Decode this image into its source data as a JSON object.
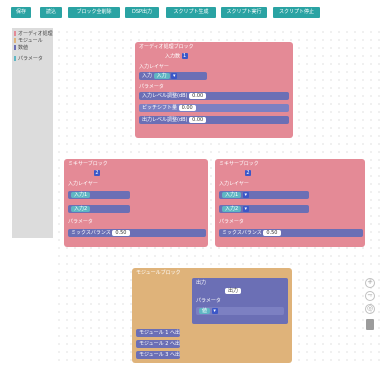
{
  "toolbar": {
    "buttons": [
      "保存",
      "読込",
      "ブロック全削除",
      "DSP出力",
      "スクリプト生成",
      "スクリプト実行",
      "スクリプト停止"
    ]
  },
  "sidebar": {
    "items": [
      {
        "label": "オーディオ処理",
        "color": "#e48a96"
      },
      {
        "label": "モジュール",
        "color": "#dfb37a"
      },
      {
        "label": "数値",
        "color": "#6b6fb5"
      },
      {
        "label": "パラメータ",
        "color": "#5fb6c4"
      }
    ]
  },
  "blocks": {
    "top_pink": {
      "header": "オーディオ処理ブロック",
      "slot_label": "入力数",
      "slot_num": "1",
      "input_label": "入力レイヤー",
      "input_value": "入力",
      "input_sel": "入力",
      "params_label": "パラメータ",
      "rows": [
        "入力レベル調整(dB)",
        "ピッチシフト量",
        "出力レベル調整(dB)"
      ],
      "row_mid": "0.00"
    },
    "mid_left": {
      "header": "ミキサーブロック",
      "slot_num": "2",
      "input_label": "入力レイヤー",
      "in1": "入力1",
      "in2": "入力2",
      "params_label": "パラメータ",
      "row": "ミックスバランス",
      "row_val": "0.50"
    },
    "mid_right": {
      "header": "ミキサーブロック",
      "slot_num": "2",
      "input_label": "入力レイヤー",
      "in1": "入力1",
      "in2": "入力2",
      "params_label": "パラメータ",
      "row": "ミックスバランス",
      "row_val": "0.50"
    },
    "bottom_orange": {
      "header": "モジュールブロック",
      "out_label": "出力",
      "out_sel": "出力",
      "lines": [
        "モジュール 1 へ出力",
        "モジュール 2 へ出力",
        "モジュール 3 へ出力"
      ],
      "param_label": "パラメータ",
      "param_val": "値"
    }
  },
  "controls": {
    "zoom_in": "+",
    "zoom_out": "−",
    "reset": "◎"
  }
}
